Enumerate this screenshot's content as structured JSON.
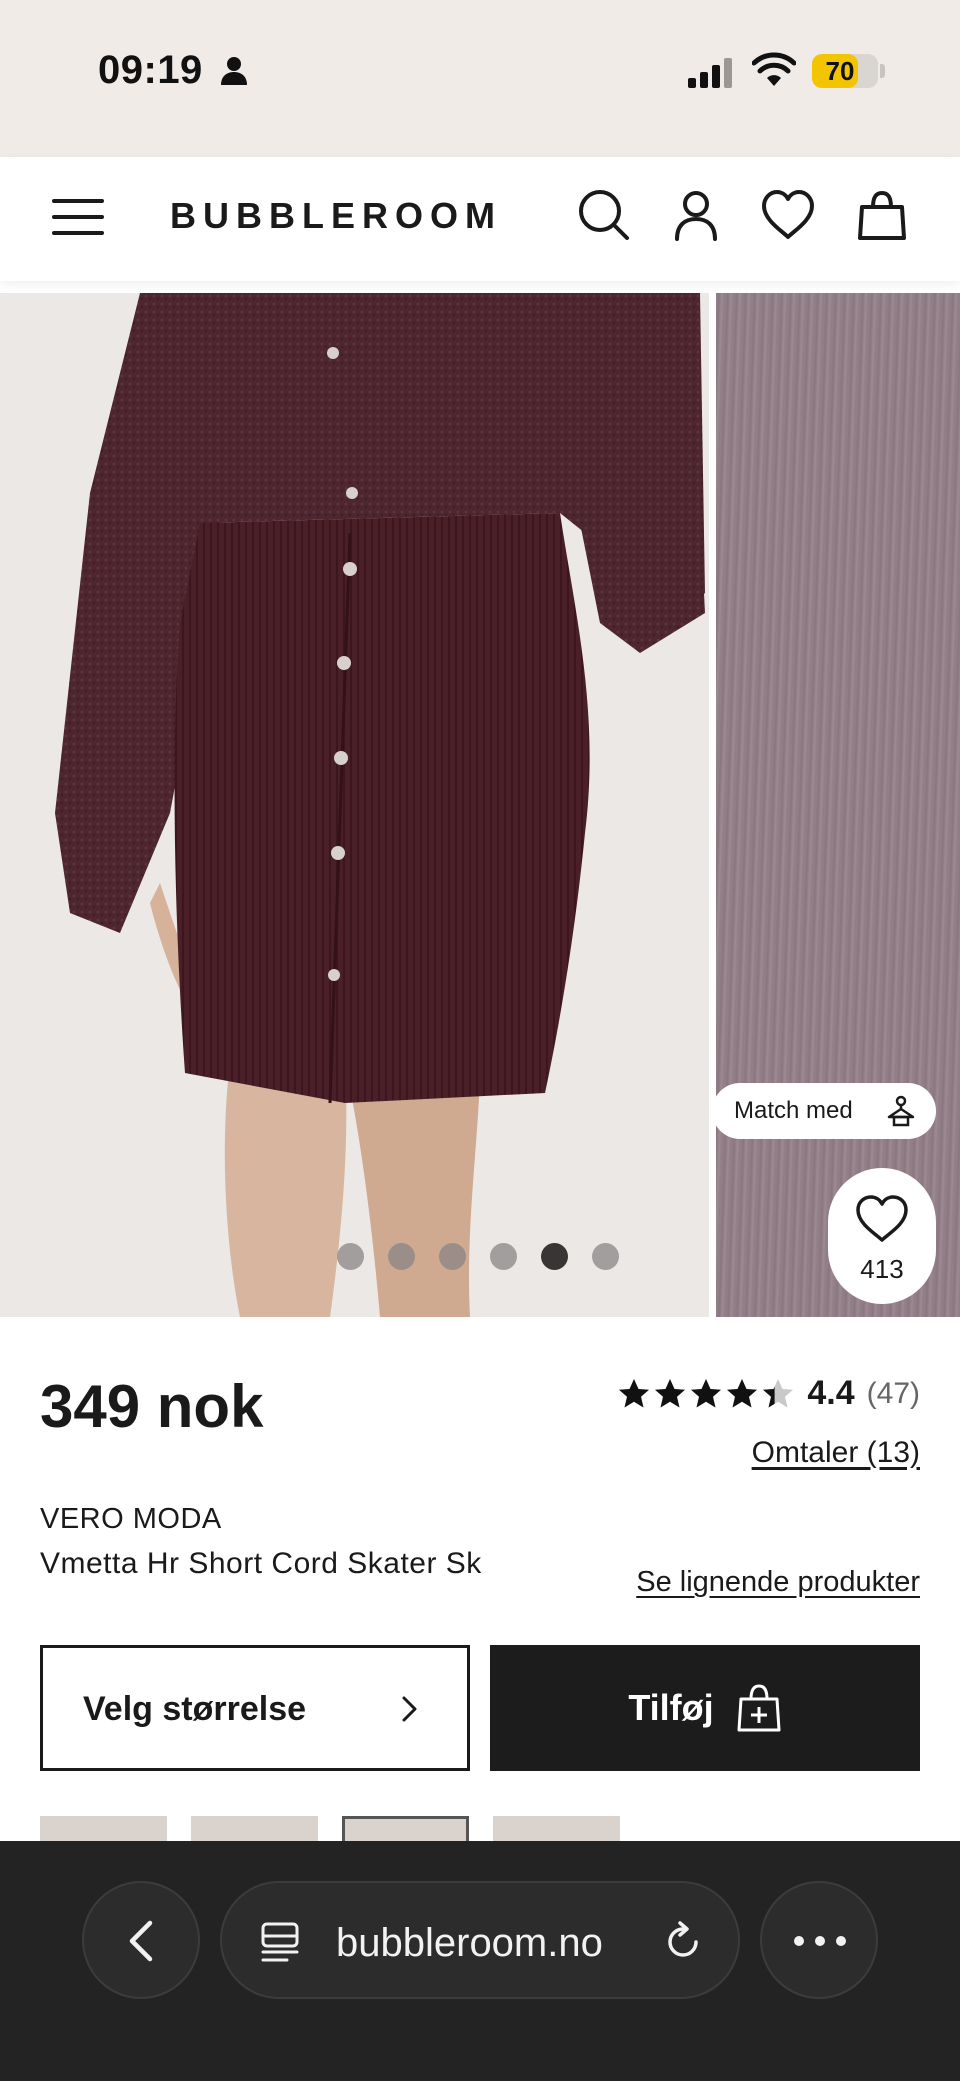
{
  "status_bar": {
    "time": "09:19",
    "battery": "70",
    "battery_level": 0.7,
    "icons": [
      "person-icon",
      "cellular-signal-icon",
      "wifi-icon",
      "battery-icon"
    ]
  },
  "header": {
    "brand": "BUBBLEROOM",
    "icons": [
      "menu-icon",
      "search-icon",
      "account-icon",
      "wishlist-heart-icon",
      "shopping-bag-icon"
    ]
  },
  "gallery": {
    "dot_count": 6,
    "active_dot_index": 4,
    "match_label": "Match med",
    "favorite_count": "413"
  },
  "product": {
    "price": "349 nok",
    "rating": "4.4",
    "rating_count": "(47)",
    "rating_stars": 4.4,
    "reviews_link": "Omtaler (13)",
    "brand": "VERO MODA",
    "name": "Vmetta Hr Short Cord Skater Sk",
    "similar_link": "Se lignende produkter"
  },
  "actions": {
    "size_button": "Velg størrelse",
    "add_button": "Tilføj"
  },
  "browser": {
    "url": "bubbleroom.no"
  },
  "colors": {
    "status_bg": "#f1ebe7",
    "skirt": "#4a1f28",
    "button_dark": "#1c1c1c",
    "browser_bg": "#232323"
  }
}
